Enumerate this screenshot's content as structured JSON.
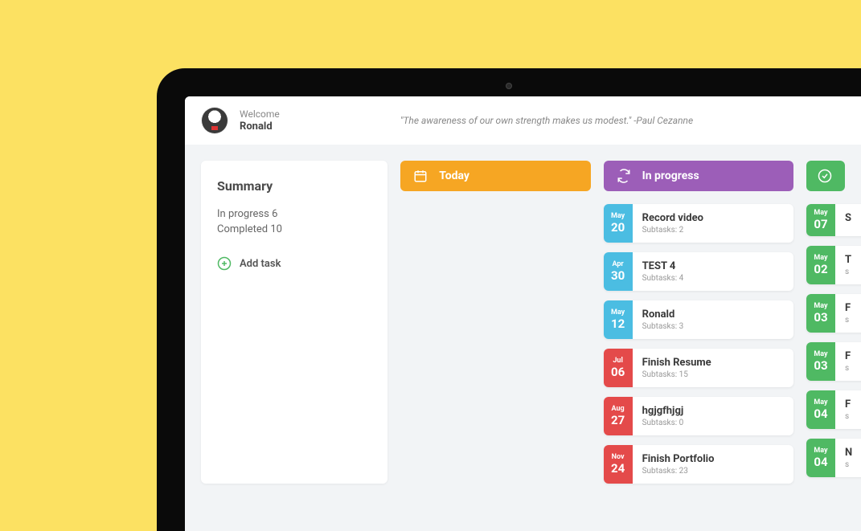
{
  "header": {
    "welcome_label": "Welcome",
    "username": "Ronald",
    "quote_text": "\"The awareness of our own strength makes us modest.\"",
    "quote_author": "-Paul Cezanne"
  },
  "summary": {
    "title": "Summary",
    "in_progress_label": "In progress",
    "in_progress_count": "6",
    "completed_label": "Completed",
    "completed_count": "10",
    "add_task_label": "Add task"
  },
  "columns": {
    "today": {
      "label": "Today"
    },
    "in_progress": {
      "label": "In progress",
      "tasks": [
        {
          "month": "May",
          "day": "20",
          "title": "Record video",
          "subtasks": "Subtasks: 2",
          "color": "blue"
        },
        {
          "month": "Apr",
          "day": "30",
          "title": "TEST 4",
          "subtasks": "Subtasks: 4",
          "color": "blue"
        },
        {
          "month": "May",
          "day": "12",
          "title": "Ronald",
          "subtasks": "Subtasks: 3",
          "color": "blue"
        },
        {
          "month": "Jul",
          "day": "06",
          "title": "Finish Resume",
          "subtasks": "Subtasks: 15",
          "color": "red"
        },
        {
          "month": "Aug",
          "day": "27",
          "title": "hgjgfhjgj",
          "subtasks": "Subtasks: 0",
          "color": "red"
        },
        {
          "month": "Nov",
          "day": "24",
          "title": "Finish Portfolio",
          "subtasks": "Subtasks: 23",
          "color": "red"
        }
      ]
    },
    "done": {
      "tasks": [
        {
          "month": "May",
          "day": "07",
          "title": "S",
          "subtasks": "",
          "color": "green"
        },
        {
          "month": "May",
          "day": "02",
          "title": "T",
          "subtasks": "s",
          "color": "green"
        },
        {
          "month": "May",
          "day": "03",
          "title": "F",
          "subtasks": "s",
          "color": "green"
        },
        {
          "month": "May",
          "day": "03",
          "title": "F",
          "subtasks": "s",
          "color": "green"
        },
        {
          "month": "May",
          "day": "04",
          "title": "F",
          "subtasks": "s",
          "color": "green"
        },
        {
          "month": "May",
          "day": "04",
          "title": "N",
          "subtasks": "s",
          "color": "green"
        }
      ]
    }
  }
}
